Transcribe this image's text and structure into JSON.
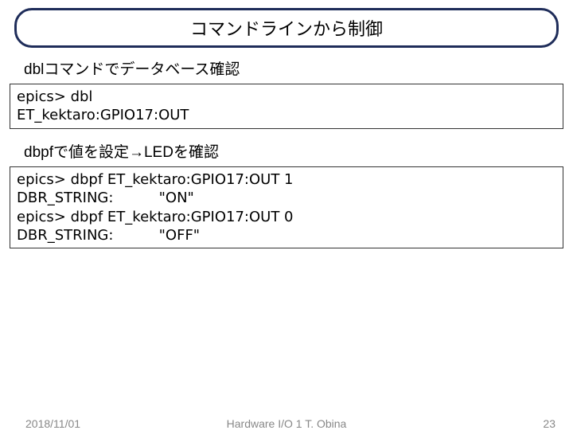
{
  "title": "コマンドラインから制御",
  "section1": {
    "heading": "dblコマンドでデータベース確認",
    "code": "epics> dbl\nET_kektaro:GPIO17:OUT"
  },
  "section2": {
    "heading": "dbpfで値を設定→LEDを確認",
    "code": "epics> dbpf ET_kektaro:GPIO17:OUT 1\nDBR_STRING:          \"ON\"\nepics> dbpf ET_kektaro:GPIO17:OUT 0\nDBR_STRING:          \"OFF\""
  },
  "footer": {
    "date": "2018/11/01",
    "center": "Hardware I/O 1 T. Obina",
    "page": "23"
  }
}
